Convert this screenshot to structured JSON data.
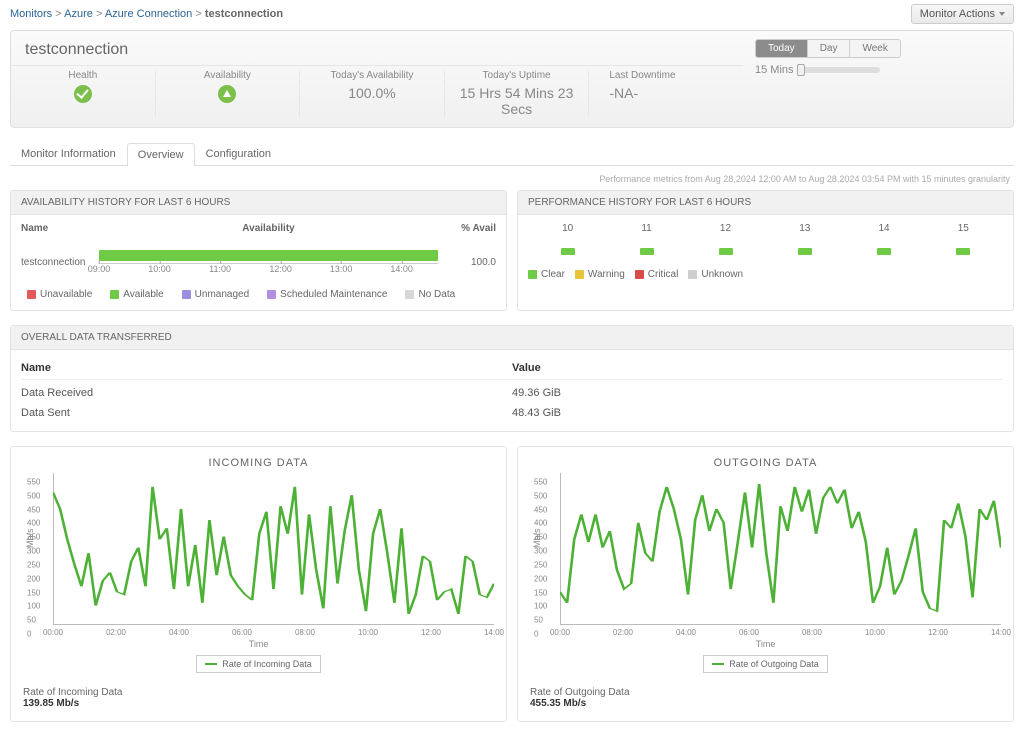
{
  "breadcrumb": {
    "p1": "Monitors",
    "p2": "Azure",
    "p3": "Azure Connection",
    "cur": "testconnection"
  },
  "actions_label": "Monitor Actions",
  "title": "testconnection",
  "range": {
    "today": "Today",
    "day": "Day",
    "week": "Week",
    "sub": "15 Mins"
  },
  "stats": {
    "health": "Health",
    "availability": "Availability",
    "today_avail_label": "Today's Availability",
    "today_avail_value": "100.0%",
    "today_uptime_label": "Today's Uptime",
    "today_uptime_value": "15 Hrs 54 Mins 23 Secs",
    "last_downtime_label": "Last Downtime",
    "last_downtime_value": "-NA-"
  },
  "tabs": {
    "info": "Monitor Information",
    "overview": "Overview",
    "config": "Configuration"
  },
  "subtext": "Performance metrics from Aug 28,2024 12:00 AM to Aug 28,2024 03:54 PM with 15 minutes granularity",
  "avail_panel": {
    "title": "AVAILABILITY HISTORY FOR LAST 6 HOURS",
    "col_name": "Name",
    "col_avail": "Availability",
    "col_pct": "% Avail",
    "row_name": "testconnection",
    "row_pct": "100.0",
    "xticks": [
      "09:00",
      "10:00",
      "11:00",
      "12:00",
      "13:00",
      "14:00"
    ],
    "legend": {
      "unavailable": "Unavailable",
      "available": "Available",
      "unmanaged": "Unmanaged",
      "scheduled": "Scheduled Maintenance",
      "nodata": "No Data"
    }
  },
  "perf_panel": {
    "title": "PERFORMANCE HISTORY FOR LAST 6 HOURS",
    "hours": [
      "10",
      "11",
      "12",
      "13",
      "14",
      "15"
    ],
    "legend": {
      "clear": "Clear",
      "warning": "Warning",
      "critical": "Critical",
      "unknown": "Unknown"
    }
  },
  "transfer_panel": {
    "title": "OVERALL DATA TRANSFERRED",
    "col_name": "Name",
    "col_value": "Value",
    "rows": [
      {
        "name": "Data Received",
        "value": "49.36 GiB"
      },
      {
        "name": "Data Sent",
        "value": "48.43 GiB"
      }
    ]
  },
  "chart_data": [
    {
      "type": "line",
      "title": "INCOMING DATA",
      "xlabel": "Time",
      "ylabel": "Mb/s",
      "ylim": [
        0,
        550
      ],
      "x": [
        "00:00",
        "02:00",
        "04:00",
        "06:00",
        "08:00",
        "10:00",
        "12:00",
        "14:00"
      ],
      "series": [
        {
          "name": "Rate of Incoming Data",
          "color": "#4db135",
          "values": [
            480,
            420,
            310,
            220,
            140,
            260,
            70,
            160,
            190,
            120,
            110,
            230,
            280,
            140,
            500,
            310,
            350,
            130,
            420,
            140,
            290,
            80,
            380,
            180,
            320,
            180,
            140,
            110,
            90,
            330,
            410,
            130,
            430,
            330,
            500,
            110,
            400,
            200,
            60,
            430,
            150,
            340,
            470,
            200,
            50,
            330,
            420,
            260,
            80,
            350,
            40,
            110,
            250,
            230,
            90,
            120,
            130,
            40,
            250,
            230,
            110,
            100,
            150
          ]
        }
      ],
      "footer_label": "Rate of Incoming Data",
      "footer_value": "139.85 Mb/s"
    },
    {
      "type": "line",
      "title": "OUTGOING DATA",
      "xlabel": "Time",
      "ylabel": "Mb/s",
      "ylim": [
        0,
        550
      ],
      "x": [
        "00:00",
        "02:00",
        "04:00",
        "06:00",
        "08:00",
        "10:00",
        "12:00",
        "14:00"
      ],
      "series": [
        {
          "name": "Rate of Outgoing Data",
          "color": "#4db135",
          "values": [
            120,
            80,
            310,
            400,
            300,
            400,
            280,
            340,
            200,
            130,
            150,
            370,
            260,
            230,
            410,
            500,
            420,
            310,
            110,
            380,
            470,
            340,
            420,
            370,
            130,
            300,
            480,
            280,
            510,
            260,
            80,
            430,
            340,
            500,
            410,
            490,
            330,
            460,
            500,
            440,
            490,
            350,
            410,
            300,
            80,
            140,
            280,
            110,
            160,
            250,
            350,
            120,
            60,
            50,
            380,
            350,
            440,
            320,
            100,
            420,
            380,
            450,
            280
          ]
        }
      ],
      "footer_label": "Rate of Outgoing Data",
      "footer_value": "455.35 Mb/s"
    }
  ],
  "colors": {
    "unavailable": "#e15b5b",
    "available": "#6FCB46",
    "unmanaged": "#9a8fe0",
    "scheduled": "#b28fe0",
    "nodata": "#d7d7d7",
    "clear": "#6FCB46",
    "warning": "#e7c53a",
    "critical": "#d94b4b",
    "unknown": "#cfcfcf"
  }
}
